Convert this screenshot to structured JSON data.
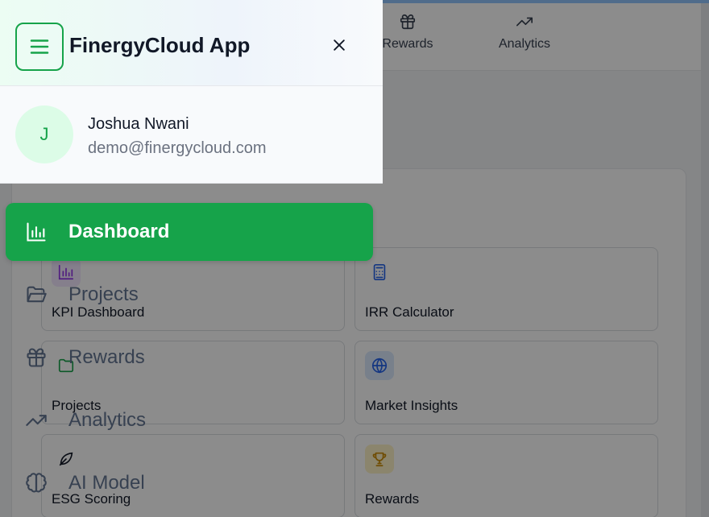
{
  "topnav": {
    "tabs": [
      {
        "label": "Rewards",
        "icon": "gift-icon"
      },
      {
        "label": "Analytics",
        "icon": "trending-up-icon"
      }
    ]
  },
  "tools": {
    "tiles": [
      {
        "label": "KPI Dashboard",
        "icon": "bar-chart-icon",
        "icon_bg": "#f3e8ff",
        "icon_color": "#9333ea"
      },
      {
        "label": "IRR Calculator",
        "icon": "calculator-icon",
        "icon_bg": "#ffffff",
        "icon_color": "#2563eb"
      },
      {
        "label": "Projects",
        "icon": "folder-icon",
        "icon_bg": "#ffffff",
        "icon_color": "#16a34a"
      },
      {
        "label": "Market Insights",
        "icon": "globe-icon",
        "icon_bg": "#dbeafe",
        "icon_color": "#2563eb"
      },
      {
        "label": "ESG Scoring",
        "icon": "leaf-icon",
        "icon_bg": "#ffffff",
        "icon_color": "#111827"
      },
      {
        "label": "Rewards",
        "icon": "trophy-icon",
        "icon_bg": "#fef3c7",
        "icon_color": "#ca8a04"
      }
    ]
  },
  "drawer": {
    "app_title": "FinergyCloud App",
    "user": {
      "initial": "J",
      "name": "Joshua Nwani",
      "email": "demo@finergycloud.com"
    },
    "nav": [
      {
        "label": "Dashboard",
        "icon": "bar-chart-icon",
        "active": true
      },
      {
        "label": "Projects",
        "icon": "folder-open-icon",
        "active": false
      },
      {
        "label": "Rewards",
        "icon": "gift-icon",
        "active": false
      },
      {
        "label": "Analytics",
        "icon": "trending-up-icon",
        "active": false
      },
      {
        "label": "AI Model",
        "icon": "brain-icon",
        "active": false
      }
    ]
  },
  "colors": {
    "brand_green": "#16a34a",
    "overlay": "rgba(0,0,0,0.45)"
  }
}
